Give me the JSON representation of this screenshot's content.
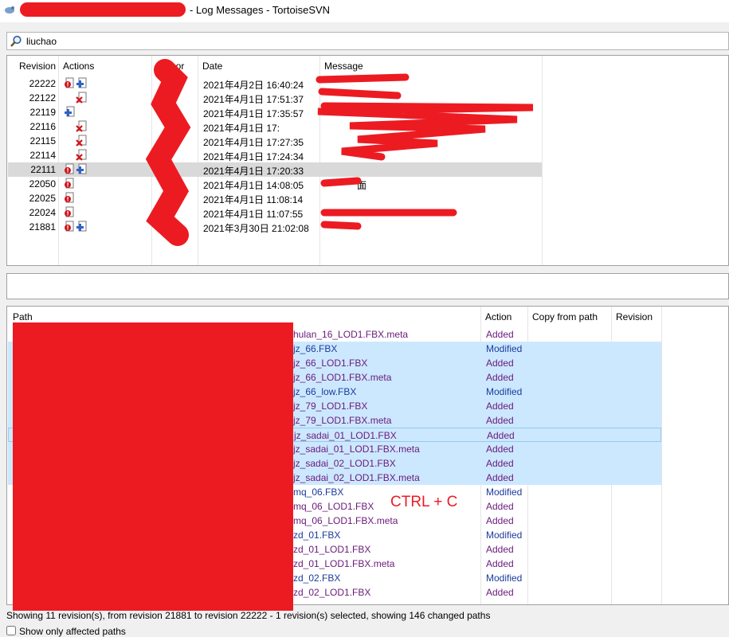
{
  "window": {
    "title_suffix": "- Log Messages - TortoiseSVN"
  },
  "search": {
    "value": "liuchao"
  },
  "log_columns": [
    "Revision",
    "Actions",
    "Author",
    "Date",
    "Message"
  ],
  "revisions": [
    {
      "rev": "22222",
      "date": "2021年4月2日 16:40:24",
      "icons": [
        "add-doc",
        "plus"
      ],
      "msg": ""
    },
    {
      "rev": "22122",
      "date": "2021年4月1日 17:51:37",
      "icons": [
        "",
        "delete"
      ],
      "msg": ""
    },
    {
      "rev": "22119",
      "date": "2021年4月1日 17:35:57",
      "icons": [
        "plus",
        ""
      ],
      "msg": ""
    },
    {
      "rev": "22116",
      "date": "2021年4月1日 17:",
      "icons": [
        "",
        "delete"
      ],
      "msg": ""
    },
    {
      "rev": "22115",
      "date": "2021年4月1日 17:27:35",
      "icons": [
        "",
        "delete"
      ],
      "msg": ""
    },
    {
      "rev": "22114",
      "date": "2021年4月1日 17:24:34",
      "icons": [
        "",
        "delete"
      ],
      "msg": ""
    },
    {
      "rev": "22111",
      "date": "2021年4月1日 17:20:33",
      "icons": [
        "add-doc",
        "plus"
      ],
      "msg": ""
    },
    {
      "rev": "22050",
      "date": "2021年4月1日 14:08:05",
      "icons": [
        "add-doc"
      ],
      "msg": "面"
    },
    {
      "rev": "22025",
      "date": "2021年4月1日 11:08:14",
      "icons": [
        "add-doc"
      ],
      "msg": ""
    },
    {
      "rev": "22024",
      "date": "2021年4月1日 11:07:55",
      "icons": [
        "add-doc"
      ],
      "msg": ""
    },
    {
      "rev": "21881",
      "date": "2021年3月30日 21:02:08",
      "icons": [
        "add-doc",
        "plus"
      ],
      "msg": ""
    }
  ],
  "path_columns": [
    "Path",
    "Action",
    "Copy from path",
    "Revision"
  ],
  "paths": [
    {
      "name": "hulan_16_LOD1.FBX.meta",
      "action": "Added"
    },
    {
      "name": "jz_66.FBX",
      "action": "Modified"
    },
    {
      "name": "jz_66_LOD1.FBX",
      "action": "Added"
    },
    {
      "name": "jz_66_LOD1.FBX.meta",
      "action": "Added"
    },
    {
      "name": "jz_66_low.FBX",
      "action": "Modified"
    },
    {
      "name": "jz_79_LOD1.FBX",
      "action": "Added"
    },
    {
      "name": "jz_79_LOD1.FBX.meta",
      "action": "Added"
    },
    {
      "name": "jz_sadai_01_LOD1.FBX",
      "action": "Added"
    },
    {
      "name": "jz_sadai_01_LOD1.FBX.meta",
      "action": "Added"
    },
    {
      "name": "jz_sadai_02_LOD1.FBX",
      "action": "Added"
    },
    {
      "name": "jz_sadai_02_LOD1.FBX.meta",
      "action": "Added"
    },
    {
      "name": "mq_06.FBX",
      "action": "Modified"
    },
    {
      "name": "mq_06_LOD1.FBX",
      "action": "Added"
    },
    {
      "name": "mq_06_LOD1.FBX.meta",
      "action": "Added"
    },
    {
      "name": "zd_01.FBX",
      "action": "Modified"
    },
    {
      "name": "zd_01_LOD1.FBX",
      "action": "Added"
    },
    {
      "name": "zd_01_LOD1.FBX.meta",
      "action": "Added"
    },
    {
      "name": "zd_02.FBX",
      "action": "Modified"
    },
    {
      "name": "zd_02_LOD1.FBX",
      "action": "Added"
    }
  ],
  "annotation": "CTRL + C",
  "status": {
    "text": "Showing 11 revision(s), from revision 21881 to revision 22222 - 1 revision(s) selected, showing 146 changed paths"
  },
  "show_only": {
    "label": "Show only affected paths",
    "checked": false
  },
  "colors": {
    "redaction": "#ec1b22",
    "selection": "#cce8ff",
    "selected_row": "#d9d9d9",
    "added": "#6a1a7a",
    "modified": "#1c3b9c"
  }
}
